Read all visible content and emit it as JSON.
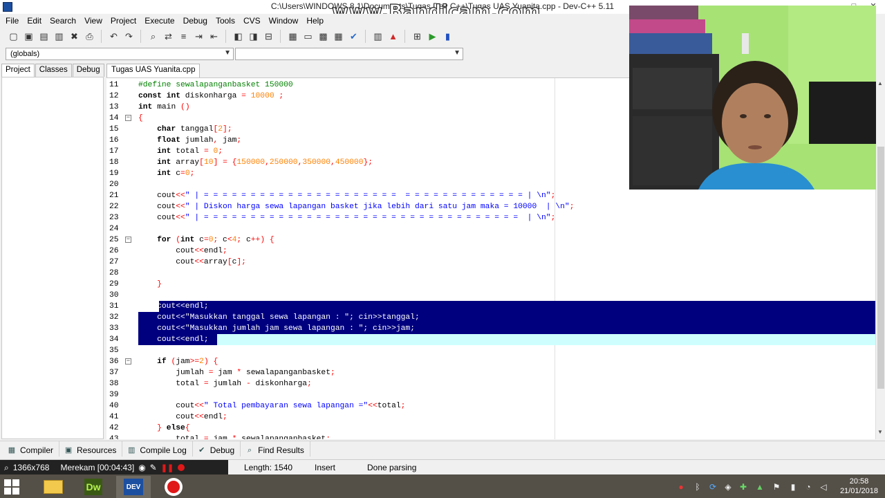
{
  "window": {
    "title": "C:\\Users\\WINDOWS 8.1\\Documents\\Tugas Dev C++\\Tugas UAS Yuanita.cpp - Dev-C++ 5.11",
    "watermark": "www.Bandicam.com",
    "controls": [
      "–",
      "□",
      "✕"
    ]
  },
  "menu": [
    "File",
    "Edit",
    "Search",
    "View",
    "Project",
    "Execute",
    "Debug",
    "Tools",
    "CVS",
    "Window",
    "Help"
  ],
  "toolbar_icons": [
    "new-file-icon",
    "open-icon",
    "save-icon",
    "save-all-icon",
    "close-icon",
    "print-icon",
    "undo-icon",
    "redo-icon",
    "find-icon",
    "replace-icon",
    "goto-icon",
    "indent-icon",
    "unindent-icon",
    "prev-icon",
    "next-icon",
    "toggle-icon",
    "new-project-icon",
    "project-options-icon",
    "class-browser-icon",
    "grid-icon",
    "check-syntax-icon",
    "chart-icon",
    "profile-icon",
    "compile-icon",
    "run-icon",
    "debug-icon"
  ],
  "combos": {
    "scope": "(globals)",
    "member": ""
  },
  "left_tabs": [
    "Project",
    "Classes",
    "Debug"
  ],
  "editor_tab": "Tugas UAS Yuanita.cpp",
  "code_lines": [
    {
      "n": "11",
      "t": "#define sewalapanganbasket 150000"
    },
    {
      "n": "12",
      "t": "const int diskonharga = 10000 ;"
    },
    {
      "n": "13",
      "t": "int main ()"
    },
    {
      "n": "14",
      "t": "{"
    },
    {
      "n": "15",
      "t": "    char tanggal[2];"
    },
    {
      "n": "16",
      "t": "    float jumlah, jam;"
    },
    {
      "n": "17",
      "t": "    int total = 0;"
    },
    {
      "n": "18",
      "t": "    int array[10] = {150000,250000,350000,450000};"
    },
    {
      "n": "19",
      "t": "    int c=0;"
    },
    {
      "n": "20",
      "t": ""
    },
    {
      "n": "21",
      "t": "    cout<<\" | = = = = = = = = = = = = = = = = = = = = =  = = = = = = = = = = = = = | \\n\";"
    },
    {
      "n": "22",
      "t": "    cout<<\" | Diskon harga sewa lapangan basket jika lebih dari satu jam maka = 10000  | \\n\";"
    },
    {
      "n": "23",
      "t": "    cout<<\" | = = = = = = = = = = = = = = = = = = = = = = = = = = = = = = = = = =  | \\n\";"
    },
    {
      "n": "24",
      "t": ""
    },
    {
      "n": "25",
      "t": "    for (int c=0; c<4; c++) {"
    },
    {
      "n": "26",
      "t": "        cout<<endl;"
    },
    {
      "n": "27",
      "t": "        cout<<array[c];"
    },
    {
      "n": "28",
      "t": ""
    },
    {
      "n": "29",
      "t": "    }"
    },
    {
      "n": "30",
      "t": ""
    },
    {
      "n": "31",
      "t": "    cout<<endl;"
    },
    {
      "n": "32",
      "t": "    cout<<\"Masukkan tanggal sewa lapangan : \"; cin>>tanggal;"
    },
    {
      "n": "33",
      "t": "    cout<<\"Masukkan jumlah jam sewa lapangan : \"; cin>>jam;"
    },
    {
      "n": "34",
      "t": "    cout<<endl;"
    },
    {
      "n": "35",
      "t": ""
    },
    {
      "n": "36",
      "t": "    if (jam>=2) {"
    },
    {
      "n": "37",
      "t": "        jumlah = jam * sewalapanganbasket;"
    },
    {
      "n": "38",
      "t": "        total = jumlah - diskonharga;"
    },
    {
      "n": "39",
      "t": ""
    },
    {
      "n": "40",
      "t": "        cout<<\" Total pembayaran sewa lapangan =\"<<total;"
    },
    {
      "n": "41",
      "t": "        cout<<endl;"
    },
    {
      "n": "42",
      "t": "    } else{"
    },
    {
      "n": "43",
      "t": "        total = jam * sewalapanganbasket;"
    }
  ],
  "fold_markers": [
    "14",
    "25",
    "36"
  ],
  "bottom_tabs": [
    {
      "label": "Compiler",
      "icon": "compiler-icon"
    },
    {
      "label": "Resources",
      "icon": "resources-icon"
    },
    {
      "label": "Compile Log",
      "icon": "compile-log-icon"
    },
    {
      "label": "Debug",
      "icon": "debug-check-icon"
    },
    {
      "label": "Find Results",
      "icon": "find-results-icon"
    }
  ],
  "recorder": {
    "resolution": "1366x768",
    "status": "Merekam [00:04:43]"
  },
  "status": {
    "length": "Length: 1540",
    "mode": "Insert",
    "parse": "Done parsing"
  },
  "taskbar": {
    "apps": [
      "explorer",
      "Dw",
      "DEV C++",
      "bandicam"
    ],
    "dw_label": "Dw",
    "dev_label": "DEV",
    "time": "20:58",
    "date": "21/01/2018"
  },
  "colors": {
    "selection": "#00007f",
    "current_line": "#cefffe",
    "string": "#0000ff",
    "number": "#ff8000",
    "preprocessor": "#008000",
    "symbol": "#ff0000"
  }
}
